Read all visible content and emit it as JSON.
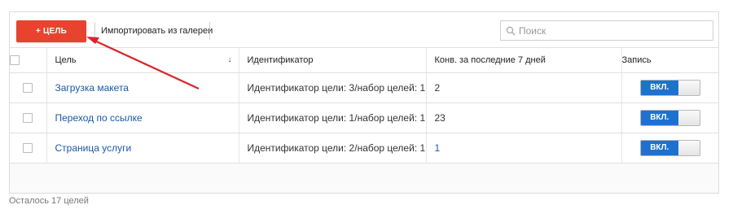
{
  "toolbar": {
    "add_label": "+ ЦЕЛЬ",
    "import_label": "Импортировать из галереи",
    "search_placeholder": "Поиск"
  },
  "table": {
    "headers": {
      "goal": "Цель",
      "goal_sort_indicator": "↓",
      "identifier": "Идентификатор",
      "conversions": "Конв. за последние 7 дней",
      "recording": "Запись"
    },
    "rows": [
      {
        "goal": "Загрузка макета",
        "identifier": "Идентификатор цели: 3/набор целей: 1",
        "conversions": "2",
        "toggle": "ВКЛ."
      },
      {
        "goal": "Переход по ссылке",
        "identifier": "Идентификатор цели: 1/набор целей: 1",
        "conversions": "23",
        "toggle": "ВКЛ."
      },
      {
        "goal": "Страница услуги",
        "identifier": "Идентификатор цели: 2/набор целей: 1",
        "conversions": "1",
        "toggle": "ВКЛ."
      }
    ]
  },
  "footer": {
    "remaining": "Осталось 17 целей"
  },
  "colors": {
    "accent_red": "#e8432e",
    "toggle_blue": "#1e72cf",
    "link_blue": "#1a58a8",
    "annotation_arrow": "#d9252a"
  }
}
